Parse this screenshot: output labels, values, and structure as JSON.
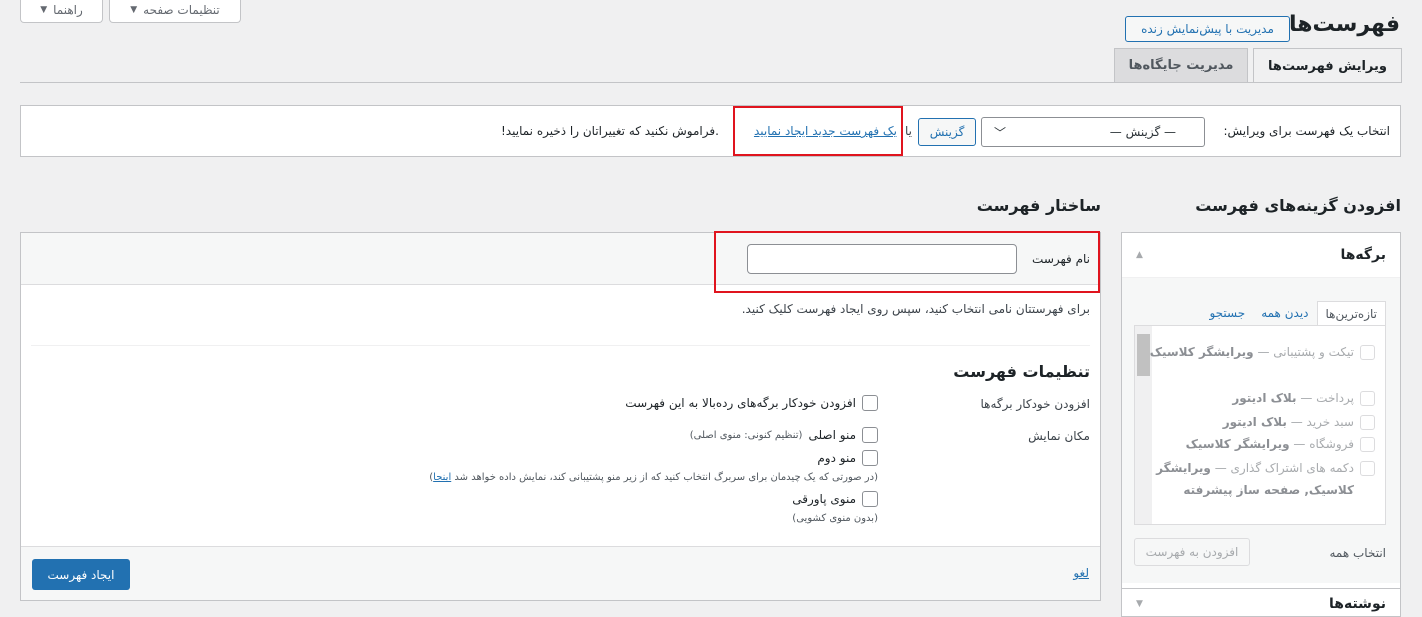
{
  "top": {
    "screen_options": "تنظیمات صفحه",
    "help": "راهنما"
  },
  "page": {
    "title": "فهرست‌ها",
    "live_preview": "مدیریت با پیش‌نمایش زنده",
    "tabs": [
      "ویرایش فهرست‌ها",
      "مدیریت جایگاه‌ها"
    ]
  },
  "select_bar": {
    "label": "انتخاب یک فهرست برای ویرایش:",
    "selected": "— گزینش —",
    "choose_button": "گزینش",
    "or": "یا",
    "create_link": "یک فهرست جدید ایجاد نمایید",
    "tail": ".فراموش نکنید که تغییراتان را ذخیره نمایید!"
  },
  "add_items": {
    "heading": "افزودن گزینه‌های فهرست",
    "pages_title": "برگه‌ها",
    "tabs": [
      "تازه‌ترین‌ها",
      "دیدن همه",
      "جستجو"
    ],
    "items": [
      {
        "plain": "تیکت و پشتیبانی — ",
        "bold": "ویرایشگر کلاسیک"
      },
      {
        "plain": "پرداخت — ",
        "bold": "بلاک ادیتور"
      },
      {
        "plain": "سبد خرید — ",
        "bold": "بلاک ادیتور"
      },
      {
        "plain": "فروشگاه — ",
        "bold": "ویرایشگر کلاسیک"
      },
      {
        "plain": "دکمه های اشتراک گذاری — ",
        "bold": "ویرایشگر کلاسیک, صفحه ساز پیشرفته"
      }
    ],
    "select_all": "انتخاب همه",
    "add_button": "افزودن به فهرست",
    "posts_title": "نوشته‌ها"
  },
  "structure": {
    "heading": "ساختار فهرست",
    "name_label": "نام فهرست",
    "name_value": "",
    "help_text": "برای فهرستتان نامی انتخاب کنید، سپس روی ایجاد فهرست کلیک کنید.",
    "settings_heading": "تنظیمات فهرست",
    "auto_add_label": "افزودن خودکار برگه‌ها",
    "auto_add_option": "افزودن خودکار برگه‌های رده‌بالا به این فهرست",
    "location_label": "مکان نمایش",
    "locations": [
      {
        "name": "منو اصلی",
        "note": "(تنظیم کنونی: منوی اصلی)"
      },
      {
        "name": "منو دوم",
        "note": "(در صورتی که یک چیدمان برای سربرگ انتخاب کنید که از زیر منو پشتیبانی کند، نمایش داده خواهد شد"
      },
      {
        "name": "منوی پاورقی",
        "note": "(بدون منوی کشویی)"
      }
    ],
    "here_link": "اینجا",
    "close_paren": ")",
    "create_button": "ایجاد فهرست",
    "cancel_link": "لغو"
  },
  "colors": {
    "accent": "#2271b1",
    "highlight": "#e0141e"
  }
}
